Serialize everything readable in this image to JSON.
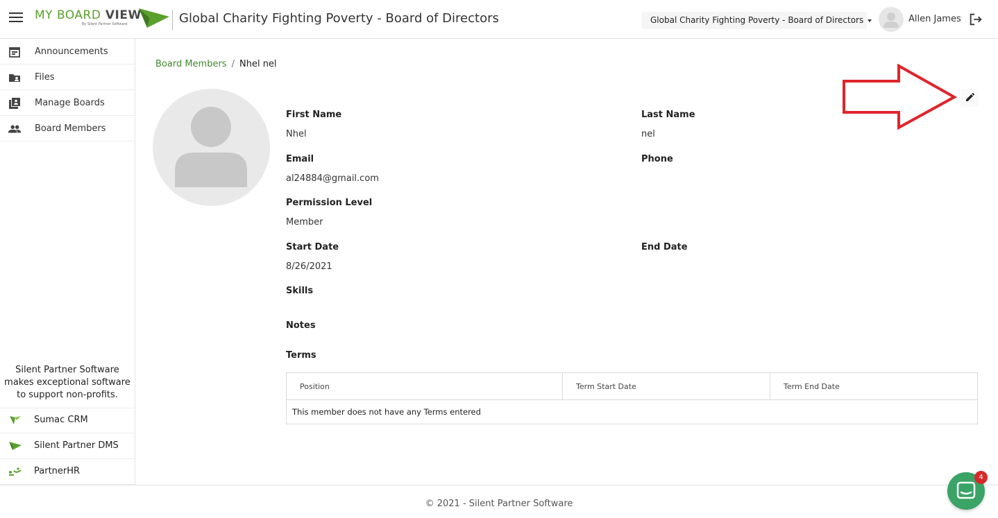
{
  "header": {
    "logo_main": "MY BOARD",
    "logo_bold": " VIEW",
    "logo_sub": "By Silent Partner Software",
    "title": "Global Charity Fighting Poverty - Board of Directors",
    "board_select_value": "Global Charity Fighting Poverty - Board of Directors",
    "user_name": "Allen James"
  },
  "sidebar": {
    "items": [
      {
        "label": "Announcements",
        "icon": "calendar-icon"
      },
      {
        "label": "Files",
        "icon": "folder-user-icon"
      },
      {
        "label": "Manage Boards",
        "icon": "boards-icon"
      },
      {
        "label": "Board Members",
        "icon": "people-icon"
      }
    ],
    "blurb": "Silent Partner Software makes exceptional software to support non-profits.",
    "partners": [
      {
        "label": "Sumac CRM",
        "icon": "sumac-icon"
      },
      {
        "label": "Silent Partner DMS",
        "icon": "dms-icon"
      },
      {
        "label": "PartnerHR",
        "icon": "partnerhr-icon"
      }
    ]
  },
  "breadcrumb": {
    "parent": "Board Members",
    "current": "Nhel nel"
  },
  "member": {
    "first_name_label": "First Name",
    "first_name": "Nhel",
    "last_name_label": "Last Name",
    "last_name": "nel",
    "email_label": "Email",
    "email": "al24884@gmail.com",
    "phone_label": "Phone",
    "phone": "",
    "permission_label": "Permission Level",
    "permission": "Member",
    "start_date_label": "Start Date",
    "start_date": "8/26/2021",
    "end_date_label": "End Date",
    "end_date": "",
    "skills_label": "Skills",
    "notes_label": "Notes",
    "terms_label": "Terms"
  },
  "terms_table": {
    "columns": [
      "Position",
      "Term Start Date",
      "Term End Date"
    ],
    "empty_message": "This member does not have any Terms entered"
  },
  "footer": {
    "text": "© 2021 - Silent Partner Software"
  },
  "chat": {
    "badge_count": "4"
  },
  "colors": {
    "brand_green": "#5aa02c",
    "link_green": "#3f8a2e",
    "annotation_red": "#e0242b",
    "chat_green": "#3aa366"
  }
}
